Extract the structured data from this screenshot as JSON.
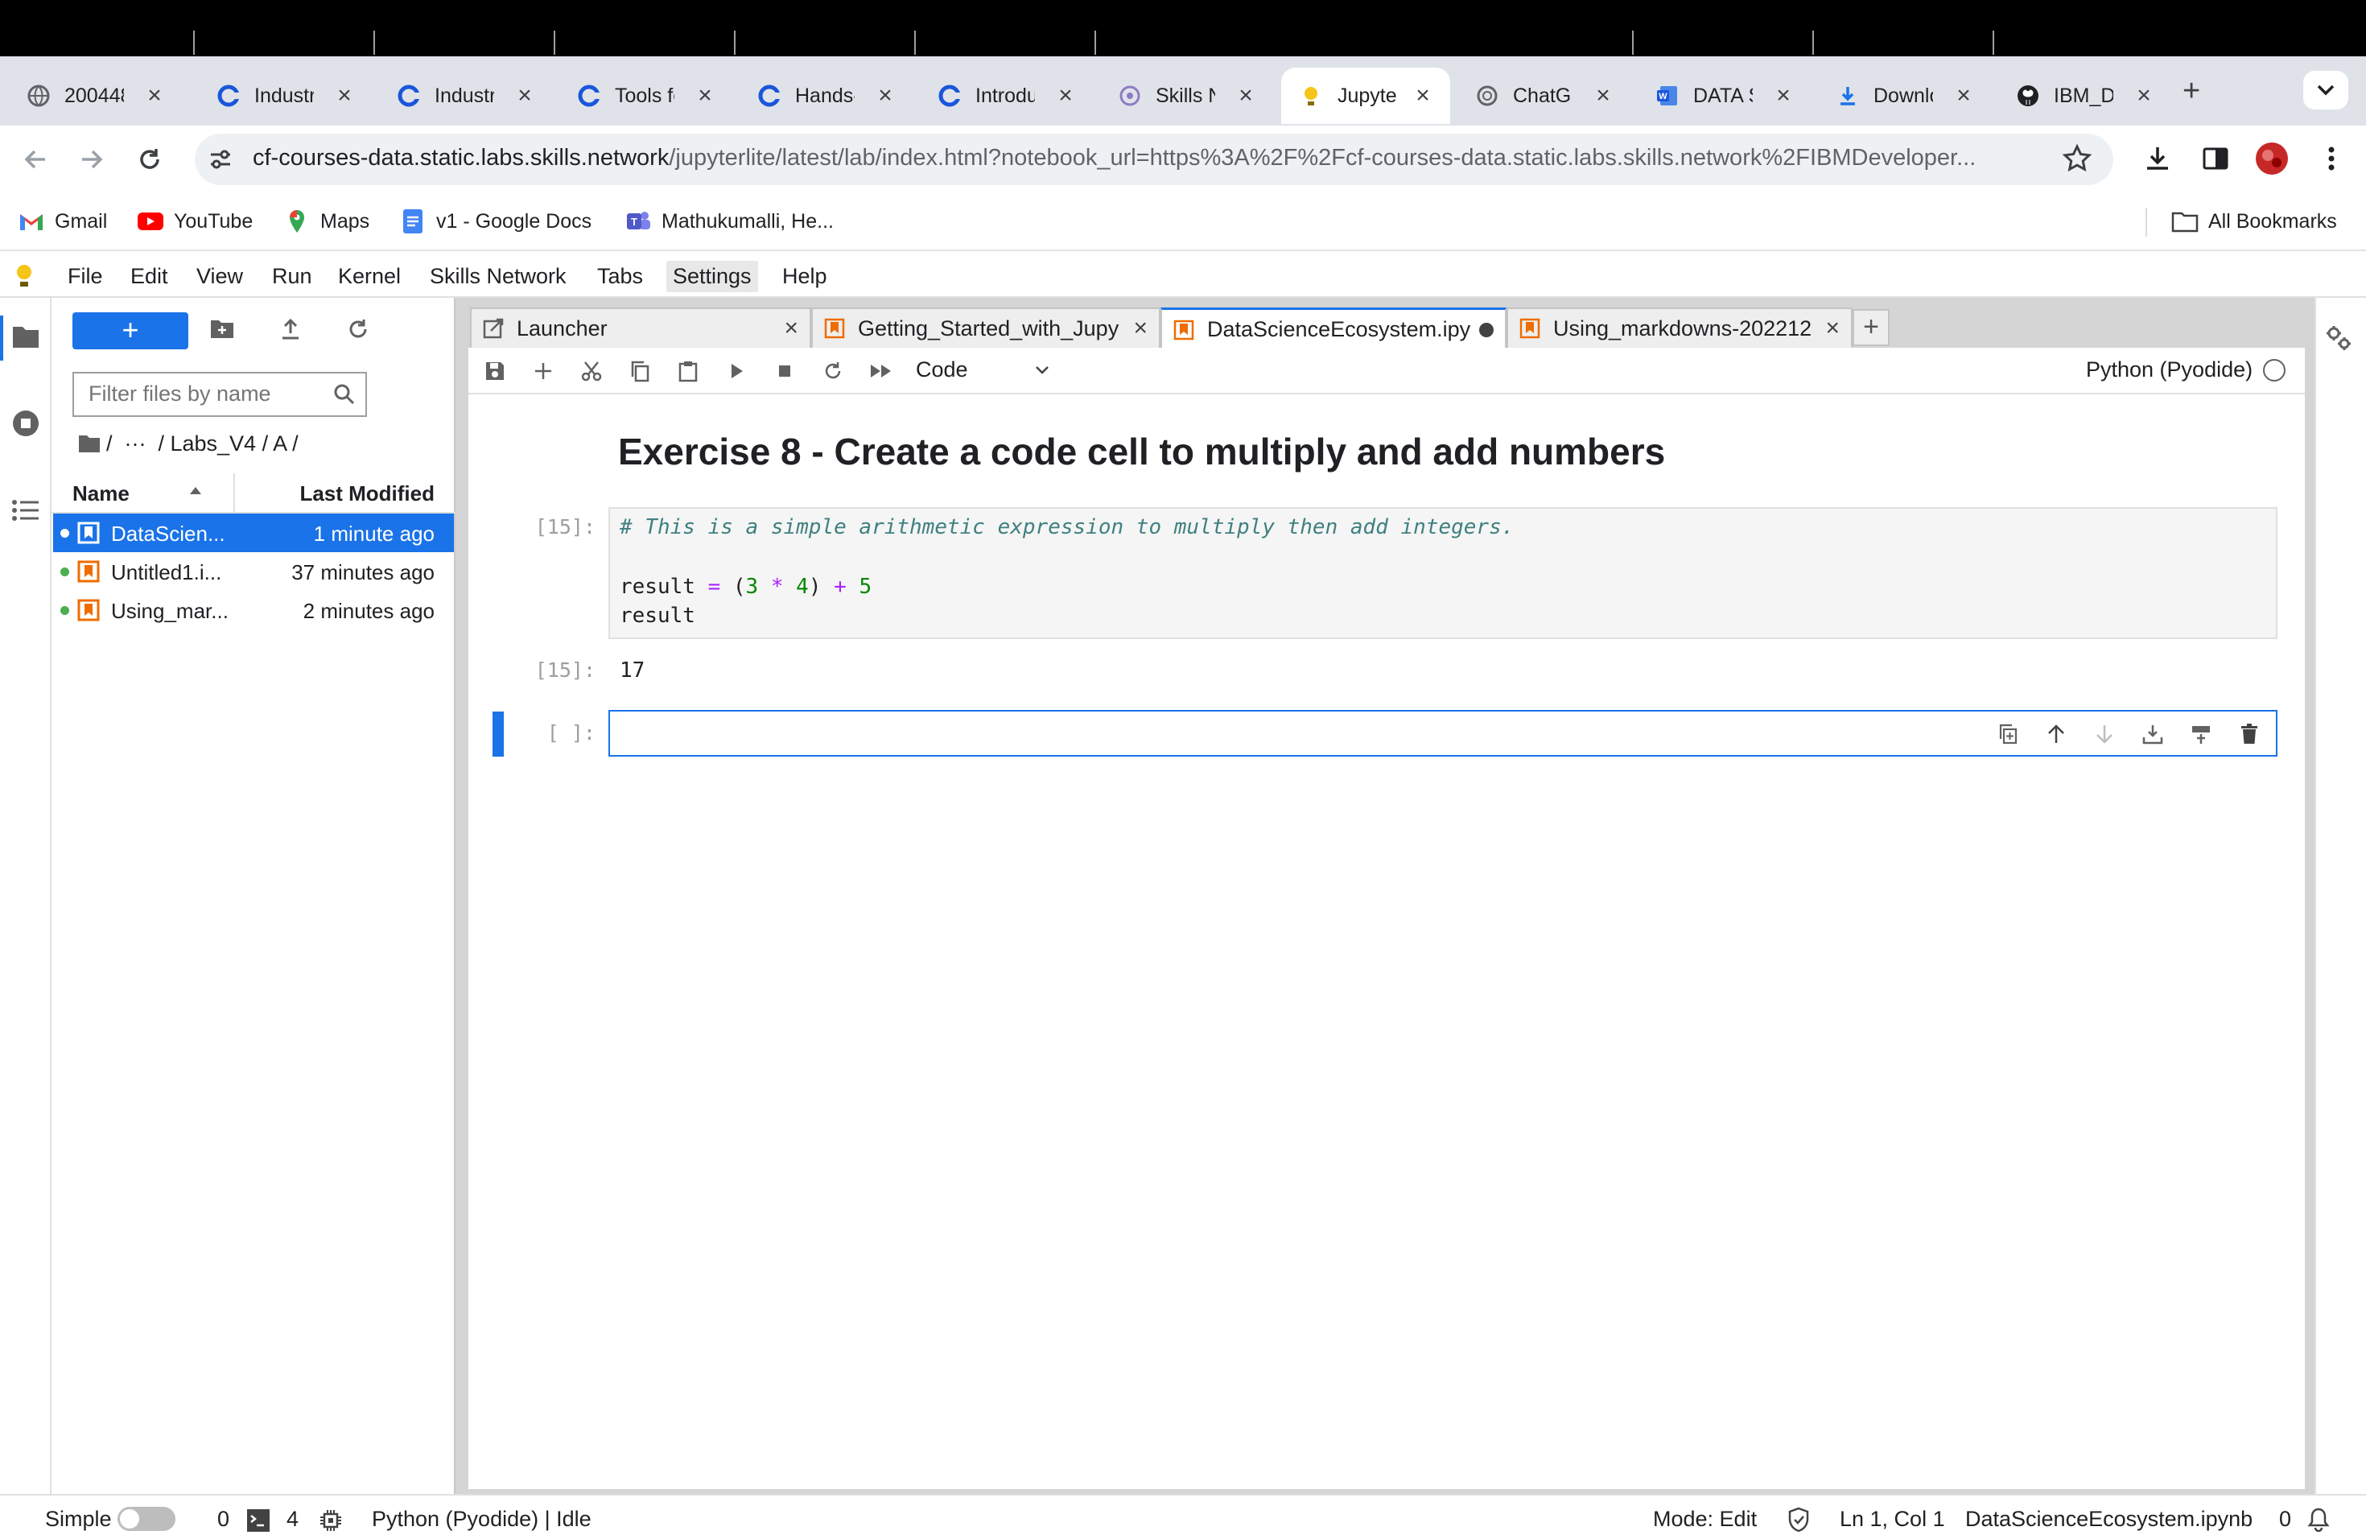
{
  "browser": {
    "tabs": [
      {
        "title": "200448",
        "icon": "globe-icon"
      },
      {
        "title": "Industr",
        "icon": "coursera-icon"
      },
      {
        "title": "Industr",
        "icon": "coursera-icon"
      },
      {
        "title": "Tools fo",
        "icon": "coursera-icon"
      },
      {
        "title": "Hands-",
        "icon": "coursera-icon"
      },
      {
        "title": "Introdu",
        "icon": "coursera-icon"
      },
      {
        "title": "Skills N",
        "icon": "skills-network-icon"
      },
      {
        "title": "Jupyter",
        "icon": "jupyterlite-icon",
        "active": true
      },
      {
        "title": "ChatGP",
        "icon": "chatgpt-icon"
      },
      {
        "title": "DATA S",
        "icon": "word-icon"
      },
      {
        "title": "Downlo",
        "icon": "download-icon"
      },
      {
        "title": "IBM_D",
        "icon": "github-icon"
      }
    ],
    "url_host": "cf-courses-data.static.labs.skills.network",
    "url_path": "/jupyterlite/latest/lab/index.html?notebook_url=https%3A%2F%2Fcf-courses-data.static.labs.skills.network%2FIBMDeveloper...",
    "bookmarks": [
      "Gmail",
      "YouTube",
      "Maps",
      "v1 - Google Docs",
      "Mathukumalli, He..."
    ],
    "all_bookmarks": "All Bookmarks"
  },
  "menubar": [
    "File",
    "Edit",
    "View",
    "Run",
    "Kernel",
    "Skills Network",
    "Tabs",
    "Settings",
    "Help"
  ],
  "filebrowser": {
    "new_label": "+",
    "filter_placeholder": "Filter files by name",
    "breadcrumb": "/  ···  / Labs_V4 / A /",
    "col_name": "Name",
    "col_modified": "Last Modified",
    "files": [
      {
        "name": "DataScien...",
        "modified": "1 minute ago",
        "selected": true
      },
      {
        "name": "Untitled1.i...",
        "modified": "37 minutes ago"
      },
      {
        "name": "Using_mar...",
        "modified": "2 minutes ago"
      }
    ]
  },
  "doc_tabs": [
    {
      "label": "Launcher"
    },
    {
      "label": "Getting_Started_with_Jupy"
    },
    {
      "label": "DataScienceEcosystem.ipy",
      "active": true,
      "unsaved": true
    },
    {
      "label": "Using_markdowns-202212"
    }
  ],
  "nb_toolbar": {
    "cell_type": "Code",
    "kernel": "Python (Pyodide)"
  },
  "notebook": {
    "heading": "Exercise 8 - Create a code cell to multiply and add numbers",
    "cell1_prompt": "[15]:",
    "code_comment": "# This is a simple arithmetic expression to multiply then add integers.",
    "code_line2": [
      "result ",
      "=",
      " (",
      "3",
      " ",
      "*",
      " ",
      "4",
      ") ",
      "+",
      " ",
      "5"
    ],
    "code_line3": "result",
    "out_prompt": "[15]:",
    "output": "17",
    "cell2_prompt": "[ ]:"
  },
  "status": {
    "mode_simple": "Simple",
    "count_a": "0",
    "count_b": "4",
    "kernel_status": "Python (Pyodide) | Idle",
    "mode": "Mode: Edit",
    "cursor": "Ln 1, Col 1",
    "filename": "DataScienceEcosystem.ipynb",
    "notifications": "0"
  },
  "colors": {
    "accent": "#1a73e8",
    "chrome_bg": "#dfe3e9"
  }
}
